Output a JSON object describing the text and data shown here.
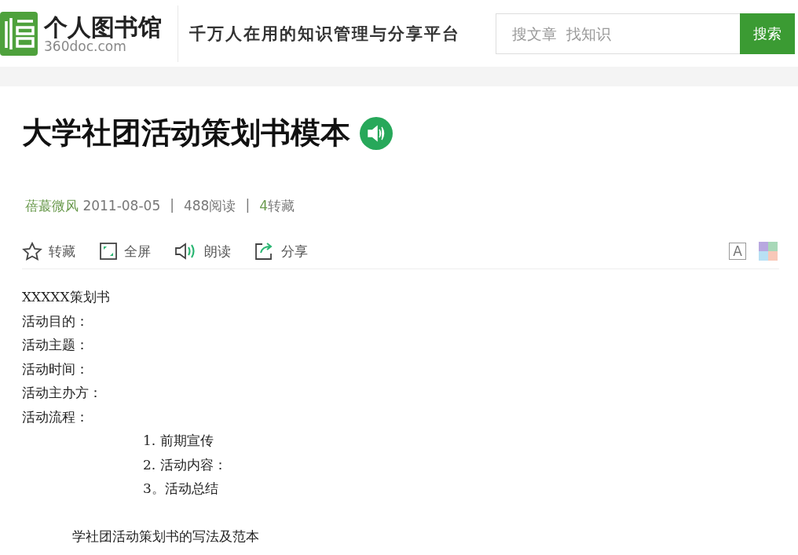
{
  "header": {
    "site_name": "个人图书馆",
    "domain": "360doc.com",
    "slogan": "千万人在用的知识管理与分享平台",
    "search": {
      "placeholder": "搜文章  找知识",
      "button": "搜索"
    }
  },
  "article": {
    "title": "大学社团活动策划书模本",
    "meta": {
      "author": "蓓蕞微风",
      "date": "2011-08-05",
      "separator_1": "|",
      "reads": "488阅读",
      "separator_2": "|",
      "saves_count": "4",
      "saves_label": "转藏"
    },
    "actions": [
      {
        "kind": "star",
        "label": "转藏"
      },
      {
        "kind": "fullscreen",
        "label": "全屏"
      },
      {
        "kind": "speaker",
        "label": "朗读"
      },
      {
        "kind": "share",
        "label": "分享"
      }
    ],
    "font_button": "A",
    "body": [
      {
        "kind": "line",
        "text": "XXXXX策划书"
      },
      {
        "kind": "line",
        "text": "活动目的："
      },
      {
        "kind": "line",
        "text": "活动主题："
      },
      {
        "kind": "line",
        "text": "活动时间："
      },
      {
        "kind": "line",
        "text": "活动主办方："
      },
      {
        "kind": "line",
        "text": "活动流程："
      },
      {
        "kind": "indent",
        "text": "1. 前期宣传"
      },
      {
        "kind": "indent",
        "text": "2. 活动内容："
      },
      {
        "kind": "indent",
        "text": "3。活动总结"
      },
      {
        "kind": "gap",
        "text": "学社团活动策划书的写法及范本"
      }
    ]
  }
}
